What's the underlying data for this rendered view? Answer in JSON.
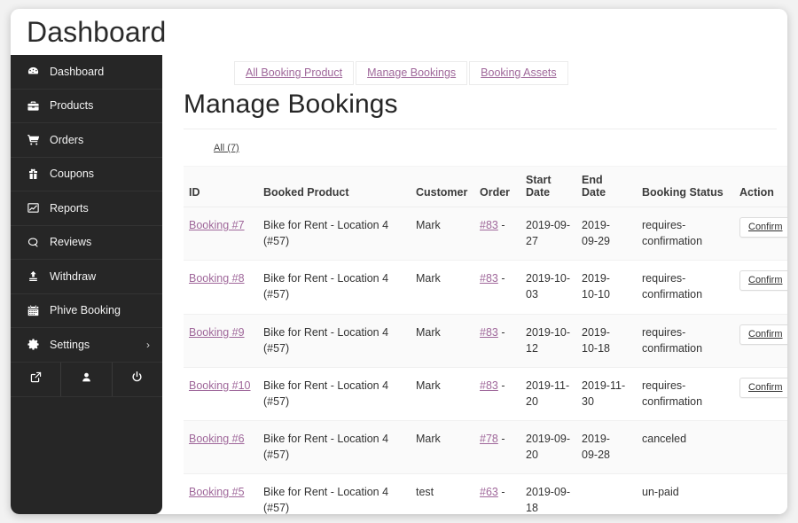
{
  "header": {
    "title": "Dashboard"
  },
  "sidebar": {
    "items": [
      {
        "label": "Dashboard",
        "icon": "gauge-icon"
      },
      {
        "label": "Products",
        "icon": "briefcase-icon"
      },
      {
        "label": "Orders",
        "icon": "cart-icon"
      },
      {
        "label": "Coupons",
        "icon": "gift-icon"
      },
      {
        "label": "Reports",
        "icon": "chart-line-icon"
      },
      {
        "label": "Reviews",
        "icon": "comment-icon"
      },
      {
        "label": "Withdraw",
        "icon": "upload-icon"
      },
      {
        "label": "Phive Booking",
        "icon": "calendar-icon"
      },
      {
        "label": "Settings",
        "icon": "gear-icon",
        "chevron": "›"
      }
    ],
    "bottom_buttons": [
      {
        "name": "visit-store-icon"
      },
      {
        "name": "user-icon"
      },
      {
        "name": "power-icon"
      }
    ]
  },
  "tabs": [
    {
      "label": "All Booking Product",
      "active": false
    },
    {
      "label": "Manage Bookings",
      "active": true
    },
    {
      "label": "Booking Assets",
      "active": false
    }
  ],
  "page": {
    "title": "Manage Bookings",
    "filter_all": "All (7)"
  },
  "table": {
    "columns": [
      "ID",
      "Booked Product",
      "Customer",
      "Order",
      "Start Date",
      "End Date",
      "Booking Status",
      "Action"
    ],
    "rows": [
      {
        "id": "Booking #7",
        "product": "Bike for Rent - Location 4 (#57)",
        "customer": "Mark",
        "order": "#83",
        "order_suffix": " -",
        "start_date": "2019-09-27",
        "end_date": "2019-09-29",
        "status": "requires-confirmation",
        "action": "Confirm"
      },
      {
        "id": "Booking #8",
        "product": "Bike for Rent - Location 4 (#57)",
        "customer": "Mark",
        "order": "#83",
        "order_suffix": " -",
        "start_date": "2019-10-03",
        "end_date": "2019-10-10",
        "status": "requires-confirmation",
        "action": "Confirm"
      },
      {
        "id": "Booking #9",
        "product": "Bike for Rent - Location 4 (#57)",
        "customer": "Mark",
        "order": "#83",
        "order_suffix": " -",
        "start_date": "2019-10-12",
        "end_date": "2019-10-18",
        "status": "requires-confirmation",
        "action": "Confirm"
      },
      {
        "id": "Booking #10",
        "product": "Bike for Rent - Location 4 (#57)",
        "customer": "Mark",
        "order": "#83",
        "order_suffix": " -",
        "start_date": "2019-11-20",
        "end_date": "2019-11-30",
        "status": "requires-confirmation",
        "action": "Confirm"
      },
      {
        "id": "Booking #6",
        "product": "Bike for Rent - Location 4 (#57)",
        "customer": "Mark",
        "order": "#78",
        "order_suffix": " -",
        "start_date": "2019-09-20",
        "end_date": "2019-09-28",
        "status": "canceled",
        "action": ""
      },
      {
        "id": "Booking #5",
        "product": "Bike for Rent - Location 4 (#57)",
        "customer": "test",
        "order": "#63",
        "order_suffix": " -",
        "start_date": "2019-09-18",
        "end_date": "",
        "status": "un-paid",
        "action": ""
      }
    ]
  },
  "colors": {
    "link": "#9f679a",
    "sidebar_bg": "#262626",
    "page_bg": "#f2f2f2"
  }
}
